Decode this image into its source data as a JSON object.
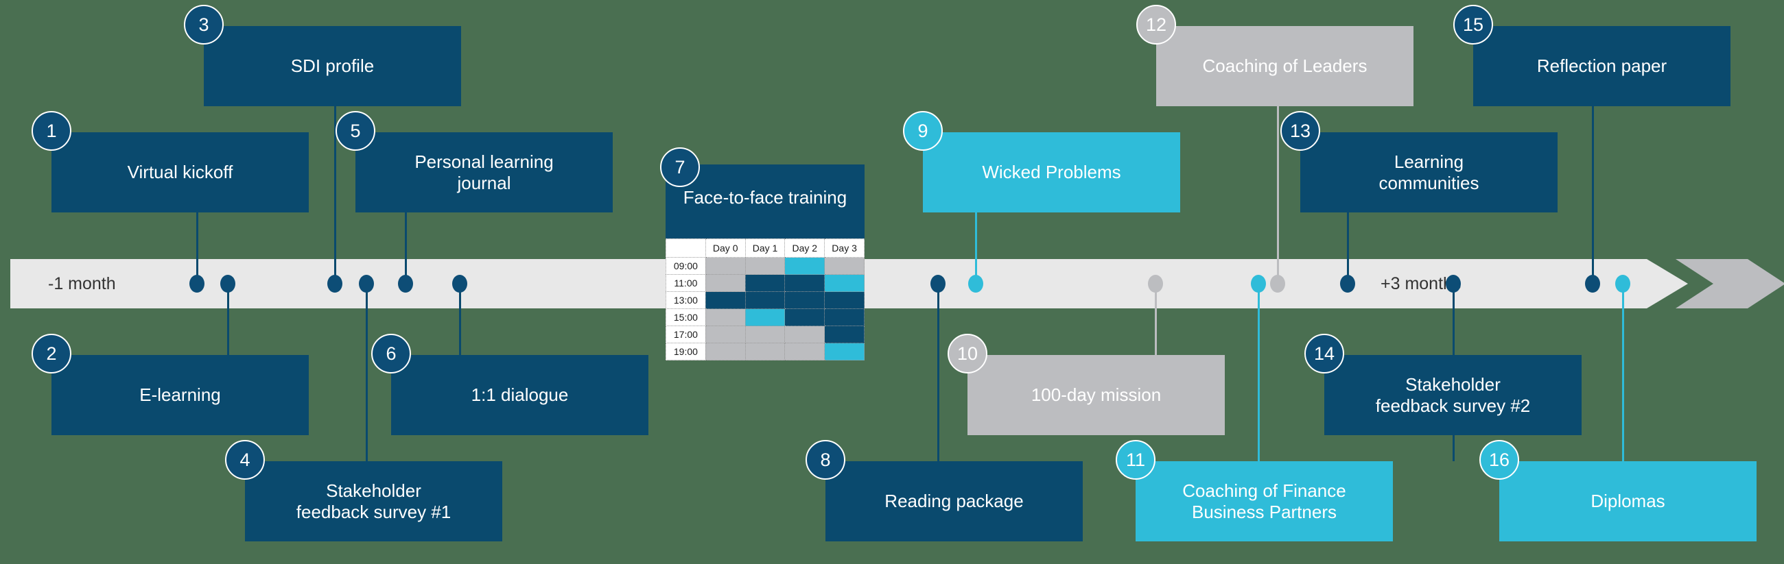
{
  "timeline": {
    "start_label": "-1 month",
    "end_label": "+3 months",
    "bar_color": "#e8e8e8",
    "arrow_color": "#bcbdc0"
  },
  "colors": {
    "navy": "#0a4a6e",
    "cyan": "#2fbcd9",
    "gray": "#bcbdc0",
    "background": "#4a6f51"
  },
  "items": [
    {
      "num": "1",
      "label": "Virtual kickoff",
      "color": "navy"
    },
    {
      "num": "2",
      "label": "E-learning",
      "color": "navy"
    },
    {
      "num": "3",
      "label": "SDI profile",
      "color": "navy"
    },
    {
      "num": "4",
      "label": "Stakeholder\nfeedback survey #1",
      "color": "navy"
    },
    {
      "num": "5",
      "label": "Personal learning\njournal",
      "color": "navy"
    },
    {
      "num": "6",
      "label": "1:1 dialogue",
      "color": "navy"
    },
    {
      "num": "7",
      "label": "Face-to-face training",
      "color": "navy"
    },
    {
      "num": "8",
      "label": "Reading package",
      "color": "navy"
    },
    {
      "num": "9",
      "label": "Wicked Problems",
      "color": "cyan"
    },
    {
      "num": "10",
      "label": "100-day mission",
      "color": "gray"
    },
    {
      "num": "11",
      "label": "Coaching of Finance\nBusiness Partners",
      "color": "cyan"
    },
    {
      "num": "12",
      "label": "Coaching of Leaders",
      "color": "gray"
    },
    {
      "num": "13",
      "label": "Learning\ncommunities",
      "color": "navy"
    },
    {
      "num": "14",
      "label": "Stakeholder\nfeedback survey #2",
      "color": "navy"
    },
    {
      "num": "15",
      "label": "Reflection paper",
      "color": "navy"
    },
    {
      "num": "16",
      "label": "Diplomas",
      "color": "cyan"
    }
  ],
  "labels": {
    "item1": "Virtual kickoff",
    "item2": "E-learning",
    "item3": "SDI profile",
    "item4_l1": "Stakeholder",
    "item4_l2": "feedback survey #1",
    "item5_l1": "Personal learning",
    "item5_l2": "journal",
    "item6": "1:1 dialogue",
    "item7": "Face-to-face training",
    "item8": "Reading package",
    "item9": "Wicked Problems",
    "item10": "100-day mission",
    "item11_l1": "Coaching of Finance",
    "item11_l2": "Business Partners",
    "item12": "Coaching of Leaders",
    "item13_l1": "Learning",
    "item13_l2": "communities",
    "item14_l1": "Stakeholder",
    "item14_l2": "feedback survey #2",
    "item15": "Reflection paper",
    "item16": "Diplomas"
  },
  "badges": {
    "b1": "1",
    "b2": "2",
    "b3": "3",
    "b4": "4",
    "b5": "5",
    "b6": "6",
    "b7": "7",
    "b8": "8",
    "b9": "9",
    "b10": "10",
    "b11": "11",
    "b12": "12",
    "b13": "13",
    "b14": "14",
    "b15": "15",
    "b16": "16"
  },
  "schedule": {
    "title": "Face-to-face training",
    "corner": "",
    "columns": [
      "Day 0",
      "Day 1",
      "Day 2",
      "Day 3"
    ],
    "rows": [
      "09:00",
      "11:00",
      "13:00",
      "15:00",
      "17:00",
      "19:00"
    ],
    "cells": [
      [
        "gray",
        "gray",
        "cyan",
        "gray"
      ],
      [
        "gray",
        "navy",
        "navy",
        "cyan"
      ],
      [
        "navy",
        "navy",
        "navy",
        "navy"
      ],
      [
        "gray",
        "cyan",
        "navy",
        "navy"
      ],
      [
        "gray",
        "gray",
        "gray",
        "navy"
      ],
      [
        "gray",
        "gray",
        "gray",
        "cyan"
      ]
    ]
  }
}
